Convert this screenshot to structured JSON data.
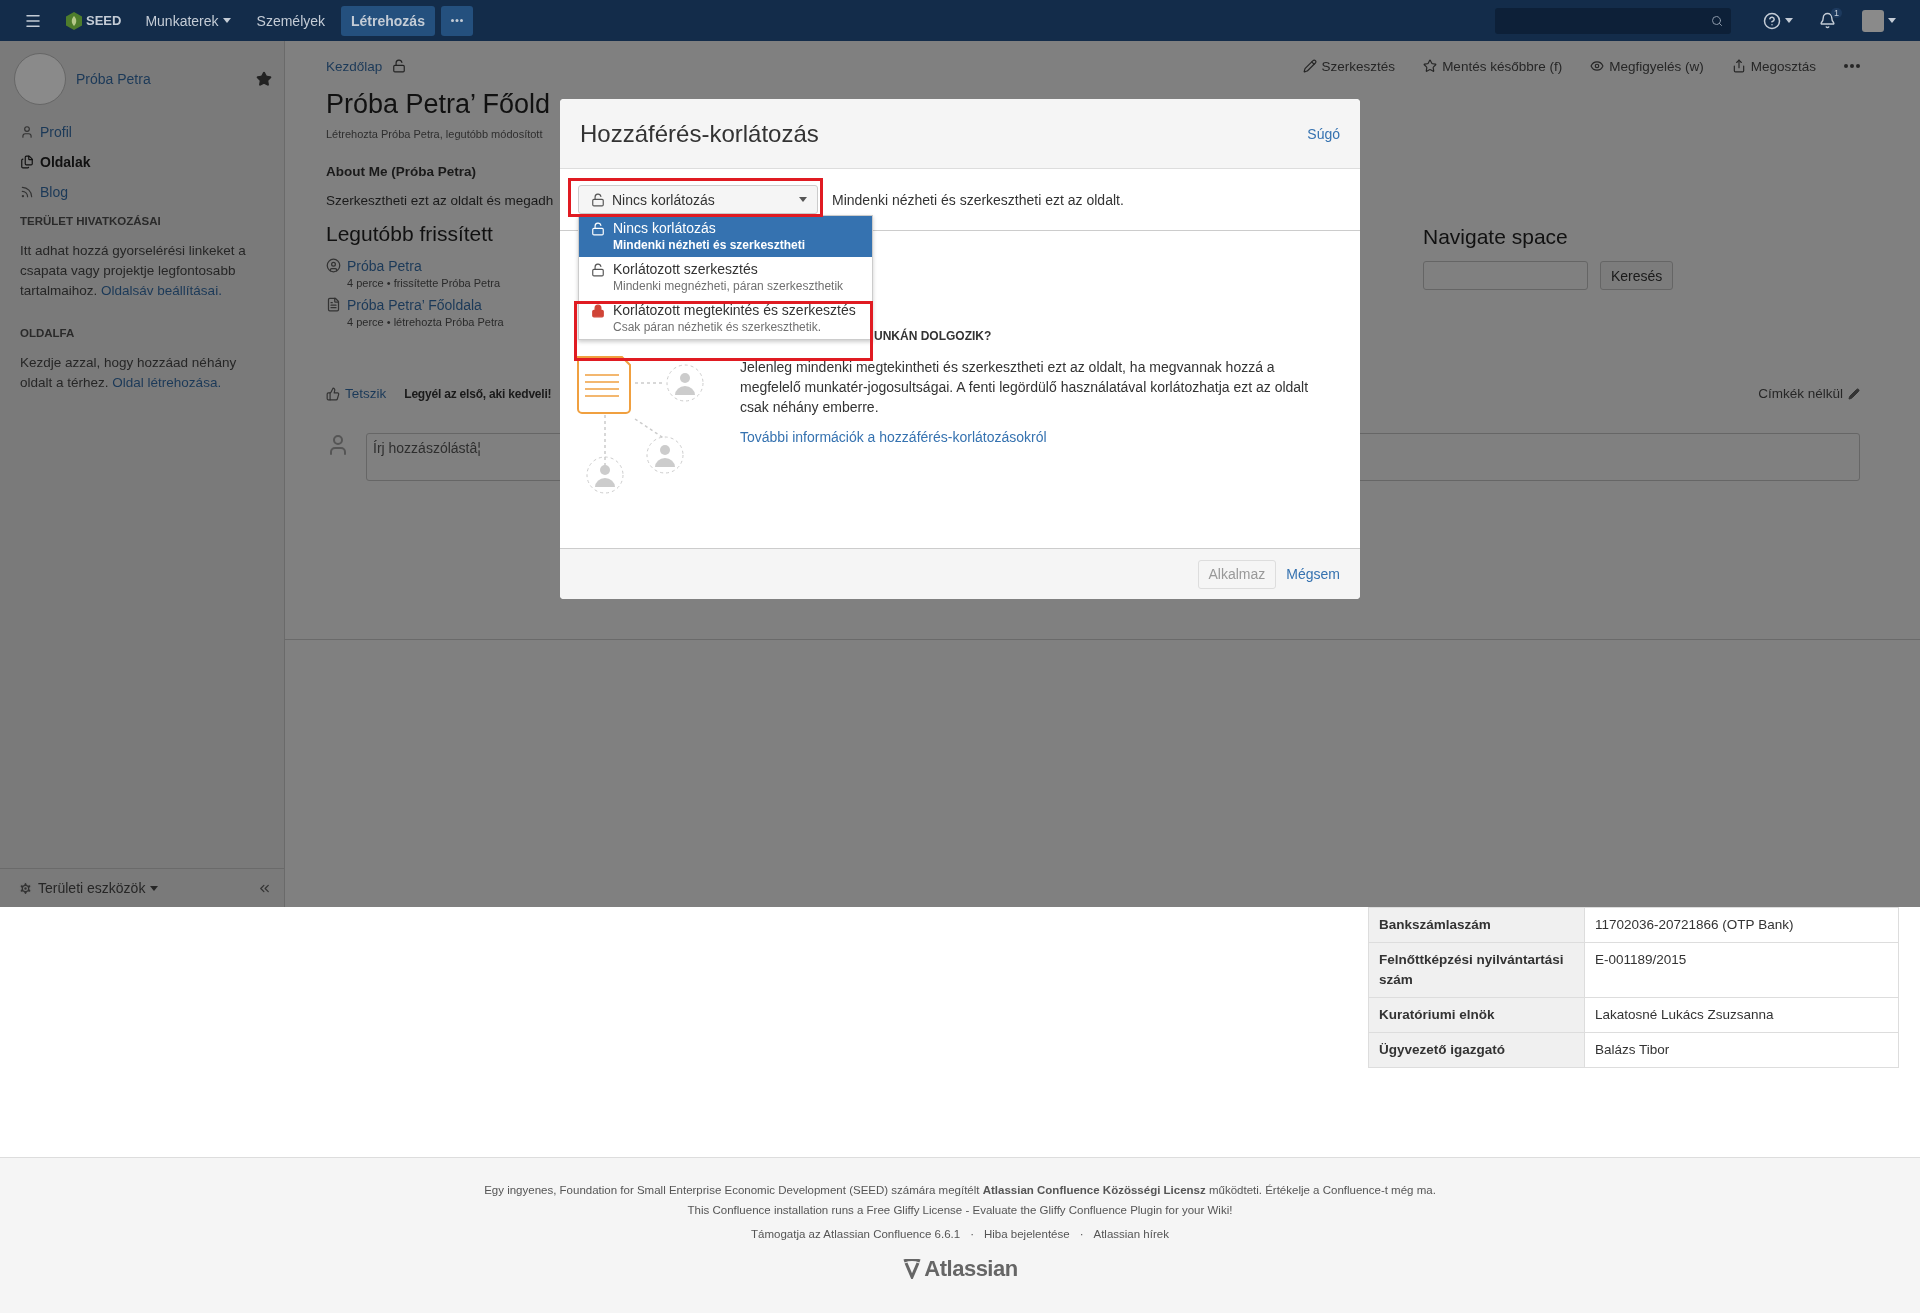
{
  "header": {
    "logo": "SEED",
    "menu": [
      {
        "label": "Munkaterek",
        "dropdown": true
      },
      {
        "label": "Személyek",
        "dropdown": false
      }
    ],
    "create": "Létrehozás",
    "notifications": "1"
  },
  "sidebar": {
    "user": "Próba Petra",
    "nav": [
      {
        "label": "Profil",
        "kind": "person",
        "selected": false
      },
      {
        "label": "Oldalak",
        "kind": "pages",
        "selected": true
      },
      {
        "label": "Blog",
        "kind": "rss",
        "selected": false
      }
    ],
    "sections": [
      {
        "title": "TERÜLET HIVATKOZÁSAI",
        "text": "Itt adhat hozzá gyorselérési linkeket a csapata vagy projektje legfontosabb tartalmaihoz.",
        "link": "Oldalsáv beállításai."
      },
      {
        "title": "OLDALFA",
        "text": "Kezdje azzal, hogy hozzáad néhány oldalt a térhez.",
        "link": "Oldal létrehozása."
      }
    ],
    "tools": "Területi eszközök"
  },
  "page": {
    "breadcrumb": "Kezdőlap",
    "actions": [
      {
        "label": "Szerkesztés",
        "kind": "edit"
      },
      {
        "label": "Mentés későbbre (f)",
        "kind": "star"
      },
      {
        "label": "Megfigyelés (w)",
        "kind": "watch"
      },
      {
        "label": "Megosztás",
        "kind": "share"
      }
    ],
    "title": "Próba Petra’ Főold",
    "meta": "Létrehozta Próba Petra, legutóbb módosított",
    "about_heading": "About Me (Próba Petra)",
    "about_text": "Szerkesztheti ezt az oldalt és megadh",
    "recent_heading": "Legutóbb frissített",
    "recent": [
      {
        "title": "Próba Petra",
        "meta": "4 perce • frissítette Próba Petra",
        "kind": "profile"
      },
      {
        "title": "Próba Petra’ Főoldala",
        "meta": "4 perce • létrehozta Próba Petra",
        "kind": "page"
      }
    ],
    "navigate_heading": "Navigate space",
    "navigate_button": "Keresés",
    "like": "Tetszik",
    "like_text": "Legyél az első, aki kedveli!",
    "labels": "Címkék nélkül",
    "comment_placeholder": "Írj hozzászólástâ¦"
  },
  "dialog": {
    "title": "Hozzáférés-korlátozás",
    "help": "Súgó",
    "select_value": "Nincs korlátozás",
    "select_description": "Mindenki nézheti és szerkesztheti ezt az oldalt.",
    "options": [
      {
        "title": "Nincs korlátozás",
        "subtitle": "Mindenki nézheti és szerkesztheti",
        "kind": "open",
        "selected": true
      },
      {
        "title": "Korlátozott szerkesztés",
        "subtitle": "Mindenki megnézheti, páran szerkeszthetik",
        "kind": "open",
        "selected": false
      },
      {
        "title": "Korlátozott megtekintés és szerkesztés",
        "subtitle": "Csak páran nézhetik és szerkeszthetik.",
        "kind": "closed",
        "selected": false
      }
    ],
    "heading": "UNKÁN DOLGOZIK?",
    "text": "Jelenleg mindenki megtekintheti és szerkesztheti ezt az oldalt, ha megvannak hozzá a megfelelő munkatér-jogosultságai. A fenti legördülő használatával korlátozhatja ezt az oldalt csak néhány emberre.",
    "link": "További információk a hozzáférés-korlátozásokról",
    "apply": {
      "label": "Alkalmaz",
      "disabled": true
    },
    "cancel": "Mégsem"
  },
  "info_table": [
    {
      "label": "Bankszámlaszám",
      "value": "11702036-20721866 (OTP Bank)"
    },
    {
      "label": "Felnőttképzési nyilvántartási szám",
      "value": "E-001189/2015"
    },
    {
      "label": "Kuratóriumi elnök",
      "value": "Lakatosné Lukács Zsuzsanna"
    },
    {
      "label": "Ügyvezető igazgató",
      "value": "Balázs Tibor"
    }
  ],
  "footer": {
    "lines": [
      "Egy ingyenes, Foundation for Small Enterprise Economic Development (SEED) számára megítélt **Atlassian Confluence Közösségi Licensz** működteti. Értékelje a Confluence-t még ma.",
      "This Confluence installation runs a Free Gliffy License - Evaluate the Gliffy Confluence Plugin for your Wiki!"
    ],
    "links": [
      "Támogatja az Atlassian Confluence 6.6.1",
      "Hiba bejelentése",
      "Atlassian hírek"
    ],
    "separator": "·",
    "logo": "Atlassian"
  }
}
